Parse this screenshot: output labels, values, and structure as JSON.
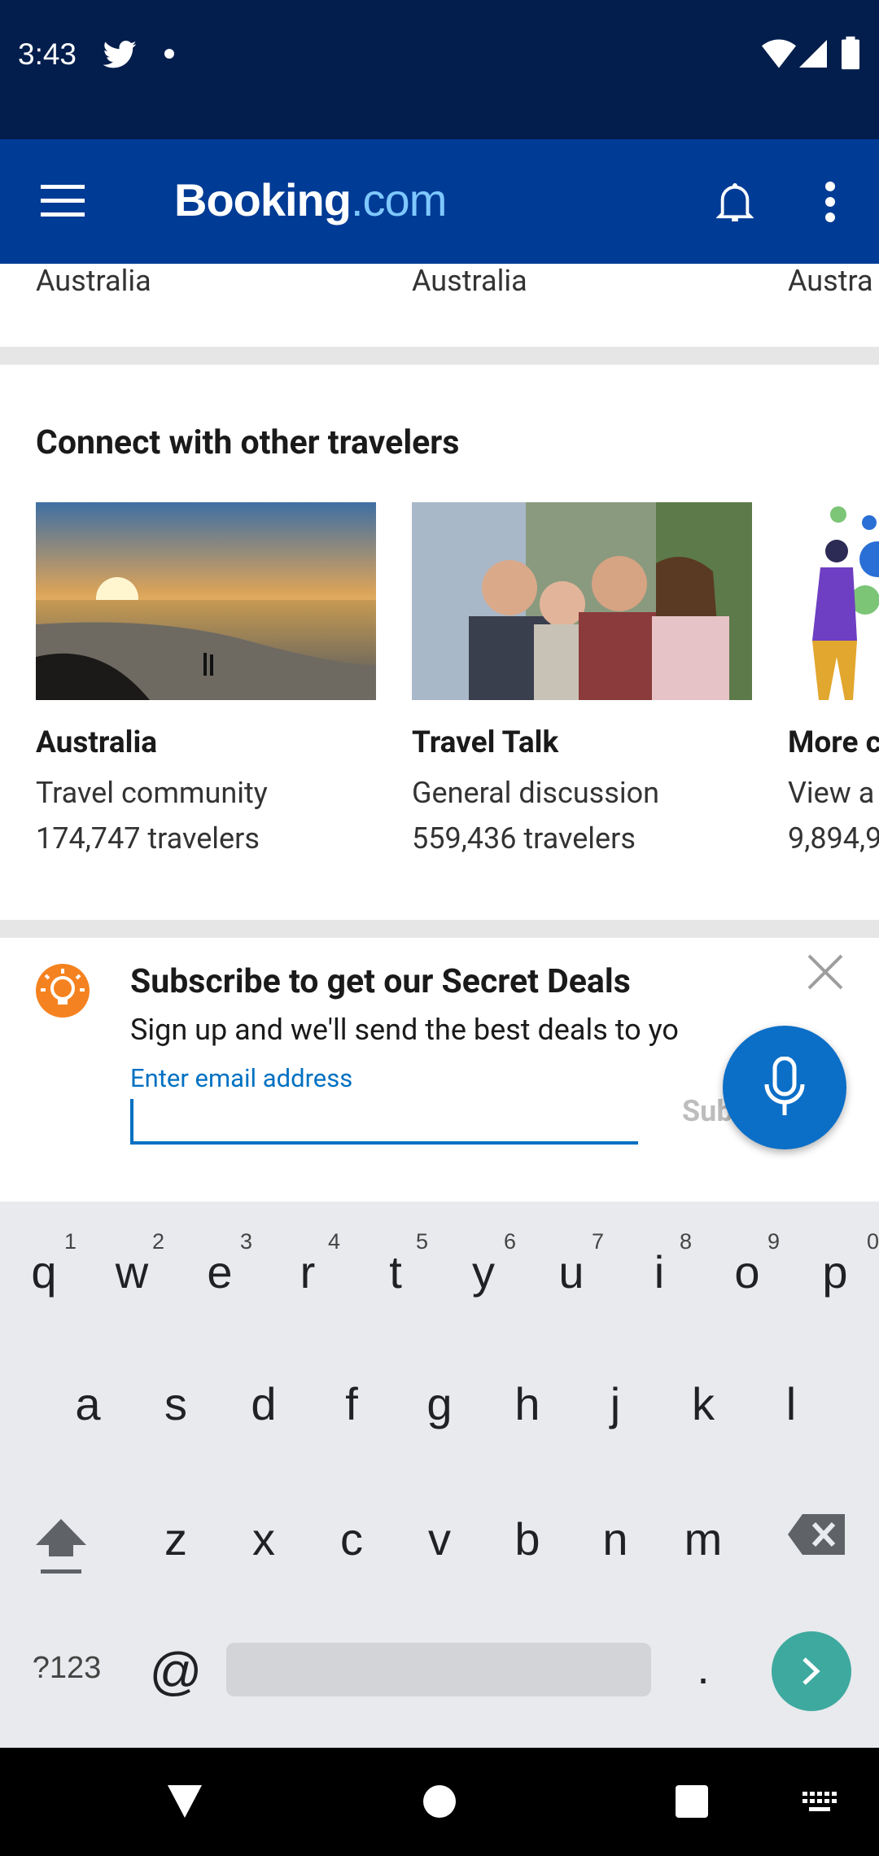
{
  "status_bar": {
    "time": "3:43"
  },
  "app_bar": {
    "logo_main": "Booking",
    "logo_dot": ".com"
  },
  "top_cards": {
    "labels": [
      "Australia",
      "Australia",
      "Austra"
    ]
  },
  "connect": {
    "title": "Connect with other travelers",
    "cards": [
      {
        "title": "Australia",
        "subtitle": "Travel community",
        "count": "174,747 travelers"
      },
      {
        "title": "Travel Talk",
        "subtitle": "General discussion",
        "count": "559,436 travelers"
      },
      {
        "title": "More c",
        "subtitle": "View a",
        "count": "9,894,9"
      }
    ]
  },
  "subscribe": {
    "title": "Subscribe to get our Secret Deals",
    "description": "Sign up and we'll send the best deals to yo",
    "email_label": "Enter email address",
    "email_value": "",
    "button": "Subscribe"
  },
  "keyboard": {
    "row1": [
      "q",
      "w",
      "e",
      "r",
      "t",
      "y",
      "u",
      "i",
      "o",
      "p"
    ],
    "row1_hints": [
      "1",
      "2",
      "3",
      "4",
      "5",
      "6",
      "7",
      "8",
      "9",
      "0"
    ],
    "row2": [
      "a",
      "s",
      "d",
      "f",
      "g",
      "h",
      "j",
      "k",
      "l"
    ],
    "row3": [
      "z",
      "x",
      "c",
      "v",
      "b",
      "n",
      "m"
    ],
    "symbols": "?123",
    "at": "@",
    "period": "."
  },
  "colors": {
    "brand_dark": "#003b95",
    "accent": "#0071c2",
    "status_bar": "#031e4d"
  }
}
